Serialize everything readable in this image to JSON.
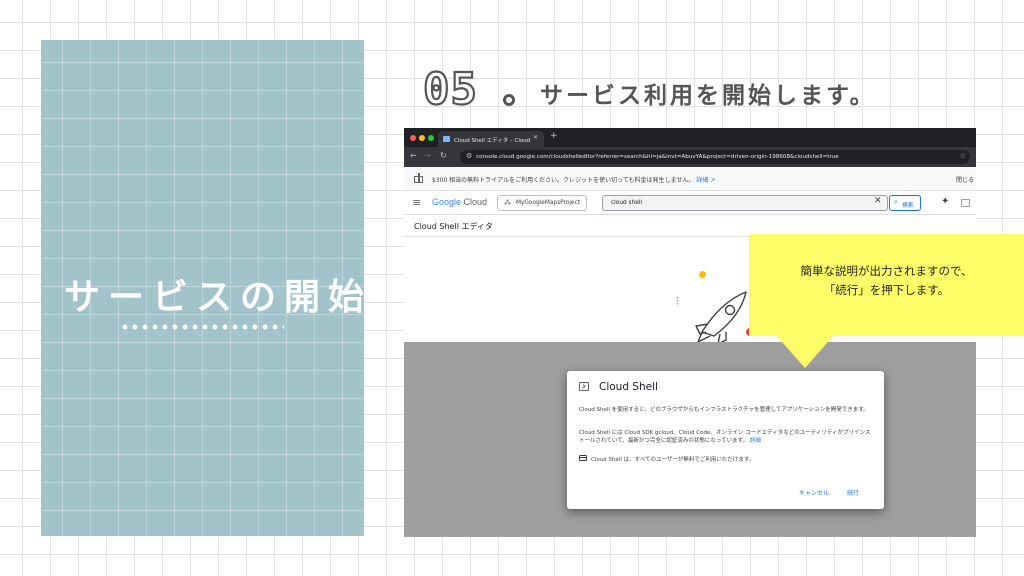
{
  "slide": {
    "section_title": "サービスの開始",
    "step_number": "05",
    "step_heading": "サービス利用を開始します。"
  },
  "callout": {
    "line1": "簡単な説明が出力されますので、",
    "line2": "「続行」を押下します。",
    "color": "#fdfd68"
  },
  "browser": {
    "tab_title": "Cloud Shell エディタ – Cloud",
    "url": "console.cloud.google.com/cloudshelleditor?referrer=search&hl=ja&invt=AbuvYA&project=driven-origin-198608&cloudshell=true"
  },
  "console": {
    "promo_text": "$300 相当の無料トライアルをご利用ください。クレジットを使い切っても料金は発生しません。",
    "promo_link": "詳細",
    "promo_close": "閉じる",
    "logo_google": "Google",
    "logo_cloud": "Cloud",
    "project_name": "MyGoogleMapsProject",
    "search_value": "cloud shell",
    "search_button": "検索",
    "page_title": "Cloud Shell エディタ"
  },
  "dialog": {
    "title": "Cloud Shell",
    "p1": "Cloud Shell を使用すると、どのブラウザからもインフラストラクチャを管理してアプリケーションを開発できます。",
    "p2": "Cloud Shell には Cloud SDK gcloud、Cloud Code、オンライン コードエディタなどのユーティリティがプリインストールされていて、最新かつ完全に認証済みの状態になっています。",
    "p2_link": "詳細",
    "p3": "Cloud Shell は、すべてのユーザーが無料でご利用いただけます。",
    "cancel_label": "キャンセル",
    "continue_label": "続行"
  },
  "colors": {
    "panel": "#a3c3cb",
    "accent_blue": "#1a73e8",
    "heading_grey": "#555555"
  }
}
